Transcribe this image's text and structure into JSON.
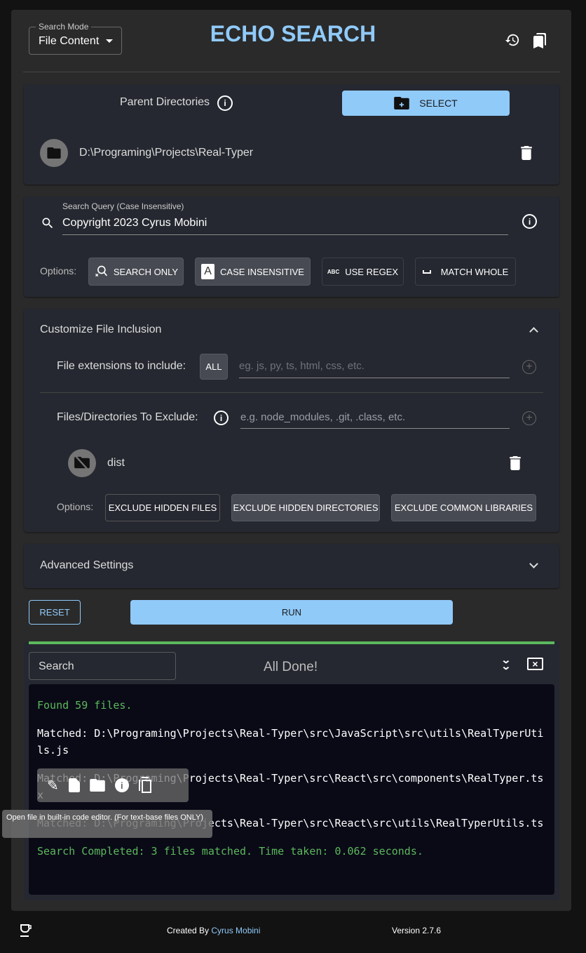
{
  "header": {
    "title": "ECHO SEARCH",
    "search_mode_label": "Search Mode",
    "search_mode_value": "File Content"
  },
  "parent_dirs": {
    "label": "Parent Directories",
    "select_label": "SELECT",
    "items": [
      "D:\\Programing\\Projects\\Real-Typer"
    ]
  },
  "query": {
    "label": "Search Query (Case Insensitive)",
    "value": "Copyright 2023 Cyrus Mobini",
    "options_label": "Options:",
    "options": [
      {
        "label": "SEARCH ONLY",
        "active": true
      },
      {
        "label": "CASE INSENSITIVE",
        "active": true
      },
      {
        "label": "USE REGEX",
        "active": false
      },
      {
        "label": "MATCH WHOLE",
        "active": false
      }
    ],
    "regex_icon_text": "ABC"
  },
  "inclusion": {
    "title": "Customize File Inclusion",
    "ext_label": "File extensions to include:",
    "all_label": "ALL",
    "ext_placeholder": "eg. js, py, ts, html, css, etc.",
    "exclude_label": "Files/Directories To Exclude:",
    "exclude_placeholder": "e.g. node_modules, .git, .class, etc.",
    "excluded": [
      "dist"
    ],
    "options_label": "Options:",
    "options": [
      {
        "label": "EXCLUDE HIDDEN FILES",
        "active": false
      },
      {
        "label": "EXCLUDE HIDDEN DIRECTORIES",
        "active": true
      },
      {
        "label": "EXCLUDE COMMON LIBRARIES",
        "active": true
      }
    ]
  },
  "advanced": {
    "title": "Advanced Settings"
  },
  "actions": {
    "reset": "RESET",
    "run": "RUN",
    "progress": 100
  },
  "results": {
    "search_placeholder": "Search",
    "status": "All Done!",
    "lines": [
      {
        "text": "Found 59 files.",
        "color": "#5cb85c"
      },
      {
        "text": "Matched: D:\\Programing\\Projects\\Real-Typer\\src\\JavaScript\\src\\utils\\RealTyperUtils.js",
        "color": "#ffffff"
      },
      {
        "text": "Matched: D:\\Programing\\Projects\\Real-Typer\\src\\React\\src\\components\\RealTyper.tsx",
        "color": "#ffffff"
      },
      {
        "text": "Matched: D:\\Programing\\Projects\\Real-Typer\\src\\React\\src\\utils\\RealTyperUtils.ts",
        "color": "#ffffff"
      },
      {
        "text": "Search Completed: 3 files matched. Time taken: 0.062 seconds.",
        "color": "#5cb85c"
      }
    ],
    "tooltip": "Open file in built-in code editor. (For text-base files ONLY)"
  },
  "footer": {
    "created_by": "Created By ",
    "author": "Cyrus Mobini",
    "version": "Version 2.7.6"
  },
  "colors": {
    "accent": "#90caf9",
    "success": "#5cb85c",
    "console_bg": "#0a0a17"
  }
}
